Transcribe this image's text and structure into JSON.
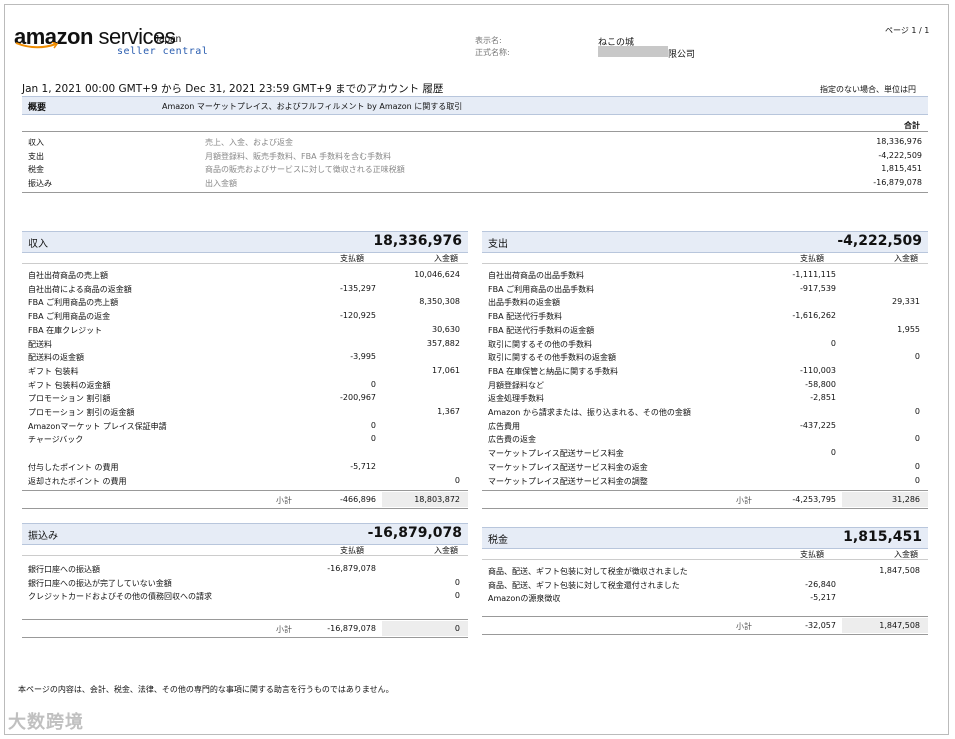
{
  "header": {
    "logo_text_main": "amazon",
    "logo_text_services": " services",
    "logo_text_region": "Japan",
    "logo_text_sub": "seller central",
    "display_name_label": "表示名:",
    "display_name": "ねこの城",
    "legal_name_label": "正式名称:",
    "legal_name_suffix": "限公司",
    "page_number": "ページ 1 / 1"
  },
  "period": {
    "title": "Jan 1, 2021 00:00 GMT+9 から Dec 31, 2021 23:59 GMT+9 までのアカウント 履歴",
    "currency_note": "指定のない場合、単位は円"
  },
  "summary": {
    "title": "概要",
    "description": "Amazon マーケットプレイス、およびフルフィルメント by Amazon に関する取引",
    "total_header": "合計",
    "rows": [
      {
        "label": "収入",
        "desc": "売上、入金、および返金",
        "value": "18,336,976"
      },
      {
        "label": "支出",
        "desc": "月額登録料、販売手数料、FBA 手数料を含む手数料",
        "value": "-4,222,509"
      },
      {
        "label": "税金",
        "desc": "商品の販売およびサービスに対して徴収される正味税額",
        "value": "1,815,451"
      },
      {
        "label": "振込み",
        "desc": "出入金額",
        "value": "-16,879,078"
      }
    ]
  },
  "income": {
    "title": "収入",
    "total": "18,336,976",
    "col_pay": "支払額",
    "col_receive": "入金額",
    "rows": [
      {
        "label": "自社出荷商品の売上額",
        "pay": "",
        "receive": "10,046,624"
      },
      {
        "label": "自社出荷による商品の返金額",
        "pay": "-135,297",
        "receive": ""
      },
      {
        "label": "FBA ご利用商品の売上額",
        "pay": "",
        "receive": "8,350,308"
      },
      {
        "label": "FBA ご利用商品の返金",
        "pay": "-120,925",
        "receive": ""
      },
      {
        "label": "FBA 在庫クレジット",
        "pay": "",
        "receive": "30,630"
      },
      {
        "label": "配送料",
        "pay": "",
        "receive": "357,882"
      },
      {
        "label": "配送料の返金額",
        "pay": "-3,995",
        "receive": ""
      },
      {
        "label": "ギフト 包装料",
        "pay": "",
        "receive": "17,061"
      },
      {
        "label": "ギフト 包装料の返金額",
        "pay": "0",
        "receive": ""
      },
      {
        "label": "プロモーション 割引額",
        "pay": "-200,967",
        "receive": ""
      },
      {
        "label": "プロモーション 割引の返金額",
        "pay": "",
        "receive": "1,367"
      },
      {
        "label": "Amazonマーケット プレイス保証申請",
        "pay": "0",
        "receive": ""
      },
      {
        "label": "チャージバック",
        "pay": "0",
        "receive": ""
      },
      {
        "label": "",
        "pay": "",
        "receive": ""
      },
      {
        "label": "付与したポイント の費用",
        "pay": "-5,712",
        "receive": ""
      },
      {
        "label": "返却されたポイント の費用",
        "pay": "",
        "receive": "0"
      }
    ],
    "subtotal_label": "小計",
    "subtotal_pay": "-466,896",
    "subtotal_receive": "18,803,872"
  },
  "expense": {
    "title": "支出",
    "total": "-4,222,509",
    "col_pay": "支払額",
    "col_receive": "入金額",
    "rows": [
      {
        "label": "自社出荷商品の出品手数料",
        "pay": "-1,111,115",
        "receive": ""
      },
      {
        "label": "FBA ご利用商品の出品手数料",
        "pay": "-917,539",
        "receive": ""
      },
      {
        "label": "出品手数料の返金額",
        "pay": "",
        "receive": "29,331"
      },
      {
        "label": "FBA 配送代行手数料",
        "pay": "-1,616,262",
        "receive": ""
      },
      {
        "label": "FBA 配送代行手数料の返金額",
        "pay": "",
        "receive": "1,955"
      },
      {
        "label": "取引に関するその他の手数料",
        "pay": "0",
        "receive": ""
      },
      {
        "label": "取引に関するその他手数料の返金額",
        "pay": "",
        "receive": "0"
      },
      {
        "label": "FBA 在庫保管と納品に関する手数料",
        "pay": "-110,003",
        "receive": ""
      },
      {
        "label": "月額登録料など",
        "pay": "-58,800",
        "receive": ""
      },
      {
        "label": "返金処理手数料",
        "pay": "-2,851",
        "receive": ""
      },
      {
        "label": "Amazon から請求または、振り込まれる、その他の金額",
        "pay": "",
        "receive": "0"
      },
      {
        "label": "広告費用",
        "pay": "-437,225",
        "receive": ""
      },
      {
        "label": "広告費の返金",
        "pay": "",
        "receive": "0"
      },
      {
        "label": "マーケットプレイス配送サービス料金",
        "pay": "0",
        "receive": ""
      },
      {
        "label": "マーケットプレイス配送サービス料金の返金",
        "pay": "",
        "receive": "0"
      },
      {
        "label": "マーケットプレイス配送サービス料金の調整",
        "pay": "",
        "receive": "0"
      }
    ],
    "subtotal_label": "小計",
    "subtotal_pay": "-4,253,795",
    "subtotal_receive": "31,286"
  },
  "transfer": {
    "title": "振込み",
    "total": "-16,879,078",
    "col_pay": "支払額",
    "col_receive": "入金額",
    "rows": [
      {
        "label": "銀行口座への振込額",
        "pay": "-16,879,078",
        "receive": ""
      },
      {
        "label": "銀行口座への振込が完了していない金額",
        "pay": "",
        "receive": "0"
      },
      {
        "label": "クレジットカードおよびその他の債務回収への請求",
        "pay": "",
        "receive": "0"
      }
    ],
    "subtotal_label": "小計",
    "subtotal_pay": "-16,879,078",
    "subtotal_receive": "0"
  },
  "tax": {
    "title": "税金",
    "total": "1,815,451",
    "col_pay": "支払額",
    "col_receive": "入金額",
    "rows": [
      {
        "label": "商品、配送、ギフト包装に対して税金が徴収されました",
        "pay": "",
        "receive": "1,847,508"
      },
      {
        "label": "商品、配送、ギフト包装に対して税金還付されました",
        "pay": "-26,840",
        "receive": ""
      },
      {
        "label": "Amazonの源泉徴収",
        "pay": "-5,217",
        "receive": ""
      }
    ],
    "subtotal_label": "小計",
    "subtotal_pay": "-32,057",
    "subtotal_receive": "1,847,508"
  },
  "footer": {
    "disclaimer": "本ページの内容は、会計、税金、法律、その他の専門的な事項に関する助言を行うものではありません。",
    "watermark": "大数跨境"
  }
}
